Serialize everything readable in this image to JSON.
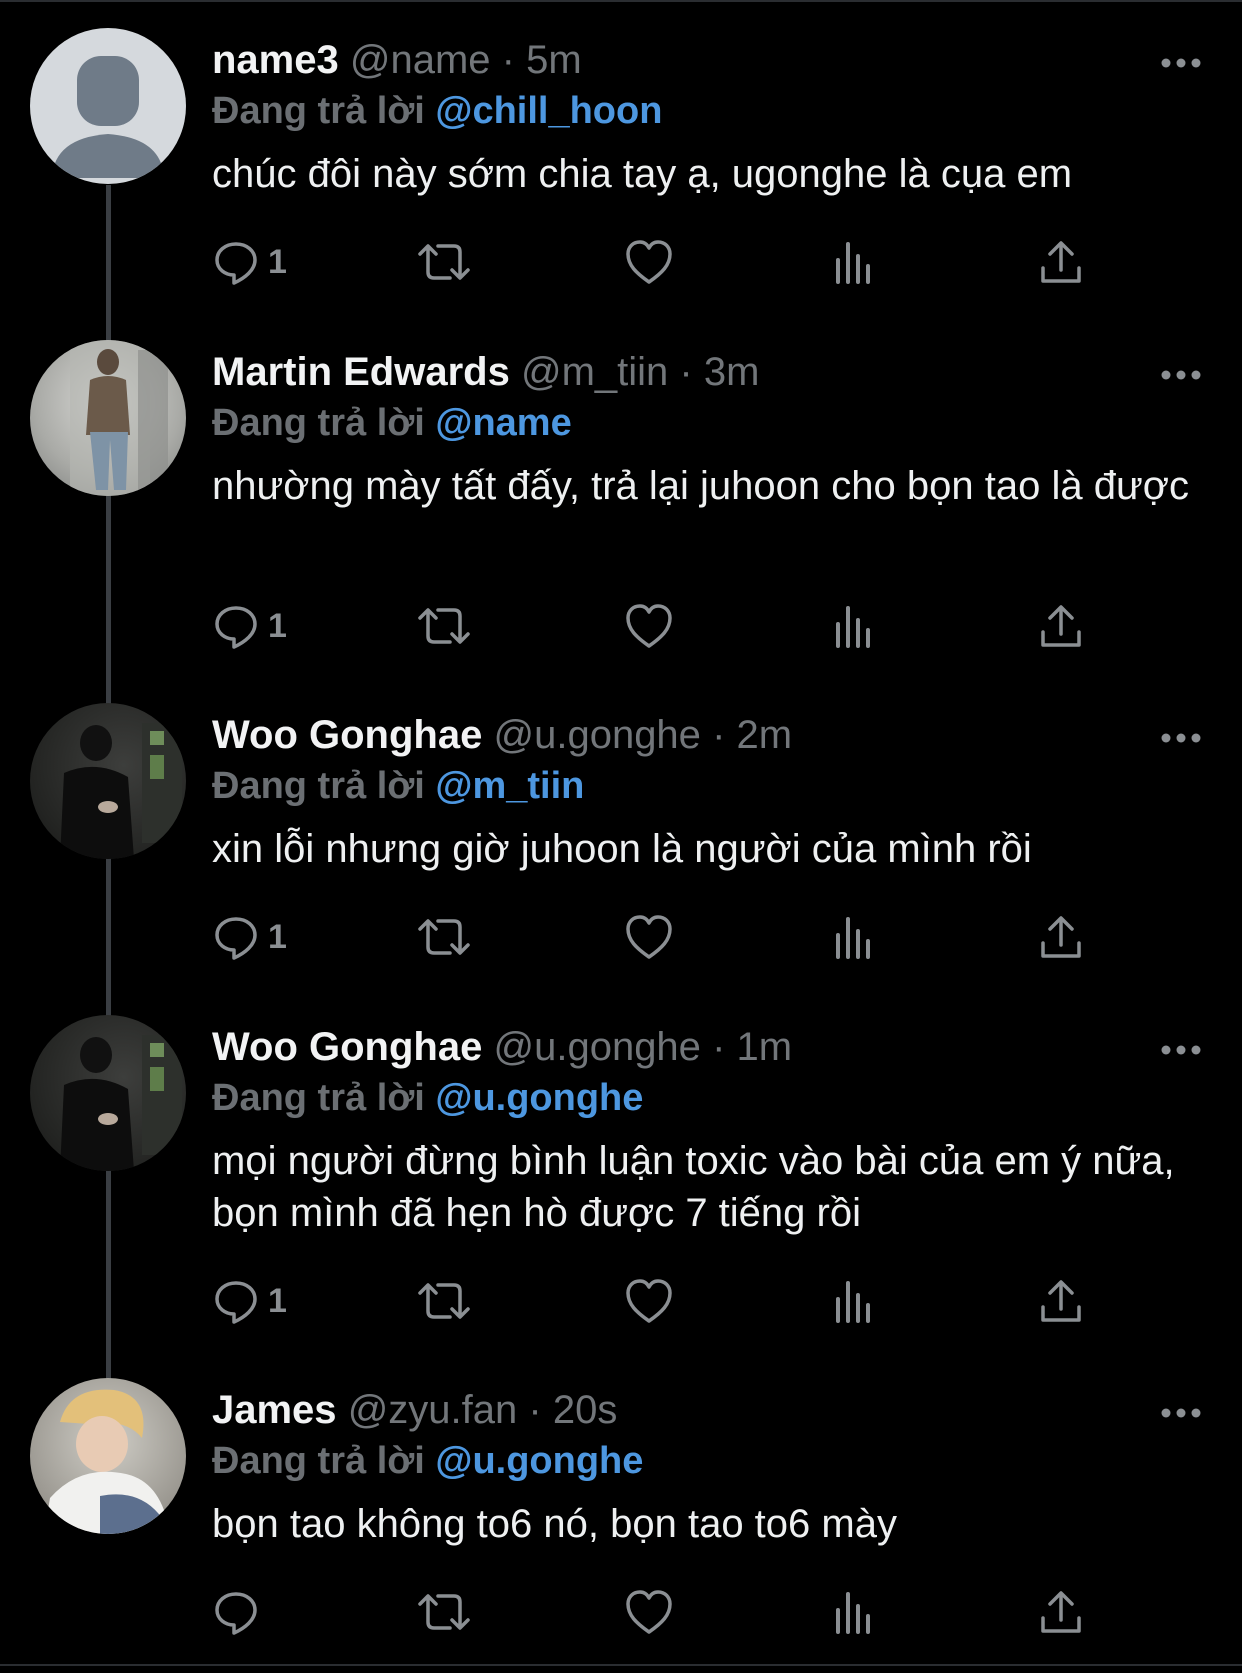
{
  "reply_label": "Đang trả lời",
  "colors": {
    "background": "#000000",
    "mention": "#4d97e0",
    "muted": "#6b6f73"
  },
  "tweets": [
    {
      "name": "name3",
      "handle": "@name",
      "time": "5m",
      "reply_to": "@chill_hoon",
      "text": "chúc đôi này sớm chia tay ạ, ugonghe là cụa em",
      "reply_count": "1",
      "avatar": "default-avatar-icon"
    },
    {
      "name": "Martin Edwards",
      "handle": "@m_tiin",
      "time": "3m",
      "reply_to": "@name",
      "text": "nhường mày tất đấy, trả lại juhoon cho bọn tao là được",
      "reply_count": "1",
      "avatar": "photo-avatar"
    },
    {
      "name": "Woo Gonghae",
      "handle": "@u.gonghe",
      "time": "2m",
      "reply_to": "@m_tiin",
      "text": "xin lỗi nhưng giờ juhoon là người của mình rồi",
      "reply_count": "1",
      "avatar": "photo-avatar"
    },
    {
      "name": "Woo Gonghae",
      "handle": "@u.gonghe",
      "time": "1m",
      "reply_to": "@u.gonghe",
      "text": "mọi người đừng bình luận toxic vào bài của em ý nữa, bọn mình đã hẹn hò được 7 tiếng rồi",
      "reply_count": "1",
      "avatar": "photo-avatar"
    },
    {
      "name": "James",
      "handle": "@zyu.fan",
      "time": "20s",
      "reply_to": "@u.gonghe",
      "text": "bọn tao không to6 nó, bọn tao to6 mày",
      "reply_count": "",
      "avatar": "photo-avatar"
    }
  ]
}
